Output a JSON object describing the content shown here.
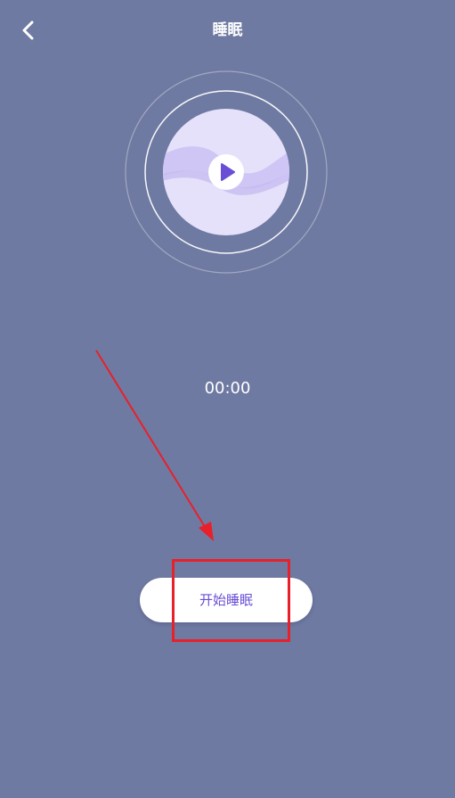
{
  "theme": {
    "background": "#6f7aa2",
    "accent": "#6a4fd6",
    "disc_face": "#e6e1fb",
    "disc_wave": "#cfc6f5",
    "annotation_red": "#e8202a"
  },
  "header": {
    "back_icon": "chevron-left-icon",
    "title": "睡眠"
  },
  "player": {
    "play_icon": "play-icon",
    "timer": "00:00"
  },
  "actions": {
    "start_label": "开始睡眠"
  }
}
